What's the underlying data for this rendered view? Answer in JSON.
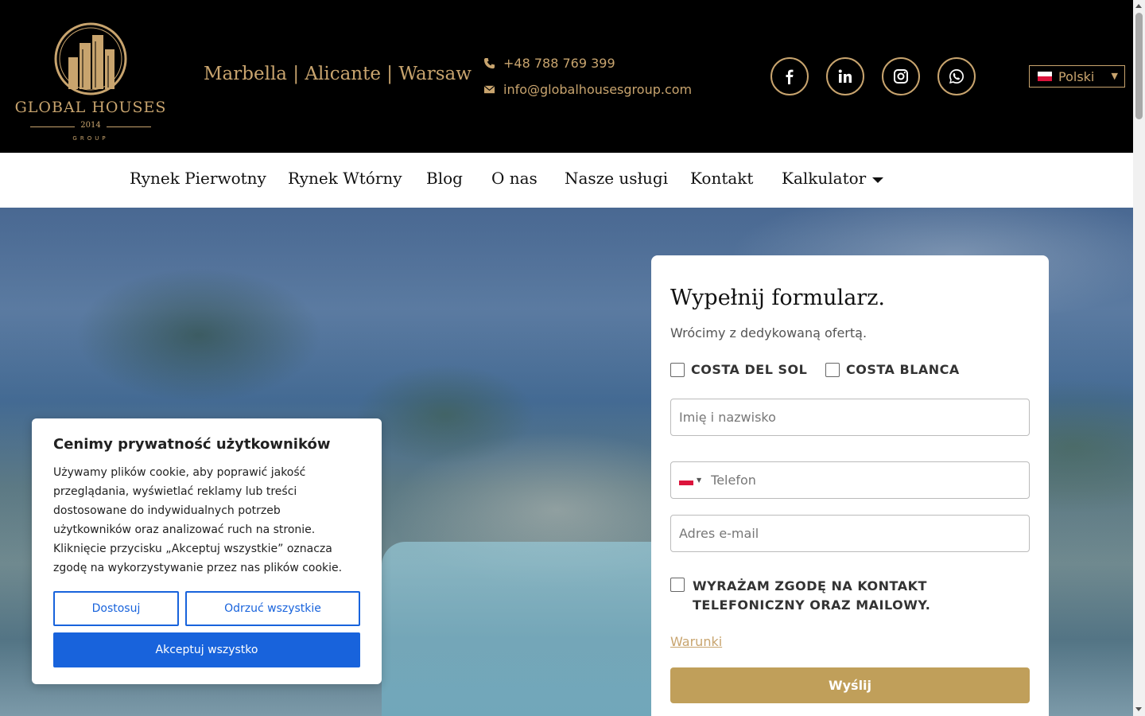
{
  "header": {
    "logo": {
      "name": "GLOBAL HOUSES",
      "year": "2014",
      "group": "GROUP"
    },
    "cities": "Marbella | Alicante | Warsaw",
    "phone": "+48 788 769 399",
    "email": "info@globalhousesgroup.com",
    "social": [
      "facebook-icon",
      "linkedin-icon",
      "instagram-icon",
      "whatsapp-icon"
    ],
    "language": "Polski"
  },
  "nav": {
    "items": [
      "Rynek Pierwotny",
      "Rynek Wtórny",
      "Blog",
      "O nas",
      "Nasze usługi",
      "Kontakt",
      "Kalkulator"
    ]
  },
  "form": {
    "title": "Wypełnij formularz.",
    "subtitle": "Wrócimy z dedykowaną ofertą.",
    "regions": [
      "COSTA DEL SOL",
      "COSTA BLANCA"
    ],
    "name_placeholder": "Imię i nazwisko",
    "phone_placeholder": "Telefon",
    "email_placeholder": "Adres e-mail",
    "consent": "WYRAŻAM ZGODĘ NA KONTAKT TELEFONICZNY ORAZ MAILOWY.",
    "terms": "Warunki",
    "submit": "Wyślij"
  },
  "cookie": {
    "title": "Cenimy prywatność użytkowników",
    "text": "Używamy plików cookie, aby poprawić jakość przeglądania, wyświetlać reklamy lub treści dostosowane do indywidualnych potrzeb użytkowników oraz analizować ruch na stronie. Kliknięcie przycisku „Akceptuj wszystkie” oznacza zgodę na wykorzystywanie przez nas plików cookie.",
    "customize": "Dostosuj",
    "reject": "Odrzuć wszystkie",
    "accept": "Akceptuj wszystko"
  },
  "colors": {
    "gold": "#c8a46e",
    "button_gold": "#c09f5a",
    "cookie_blue": "#1863dc"
  }
}
